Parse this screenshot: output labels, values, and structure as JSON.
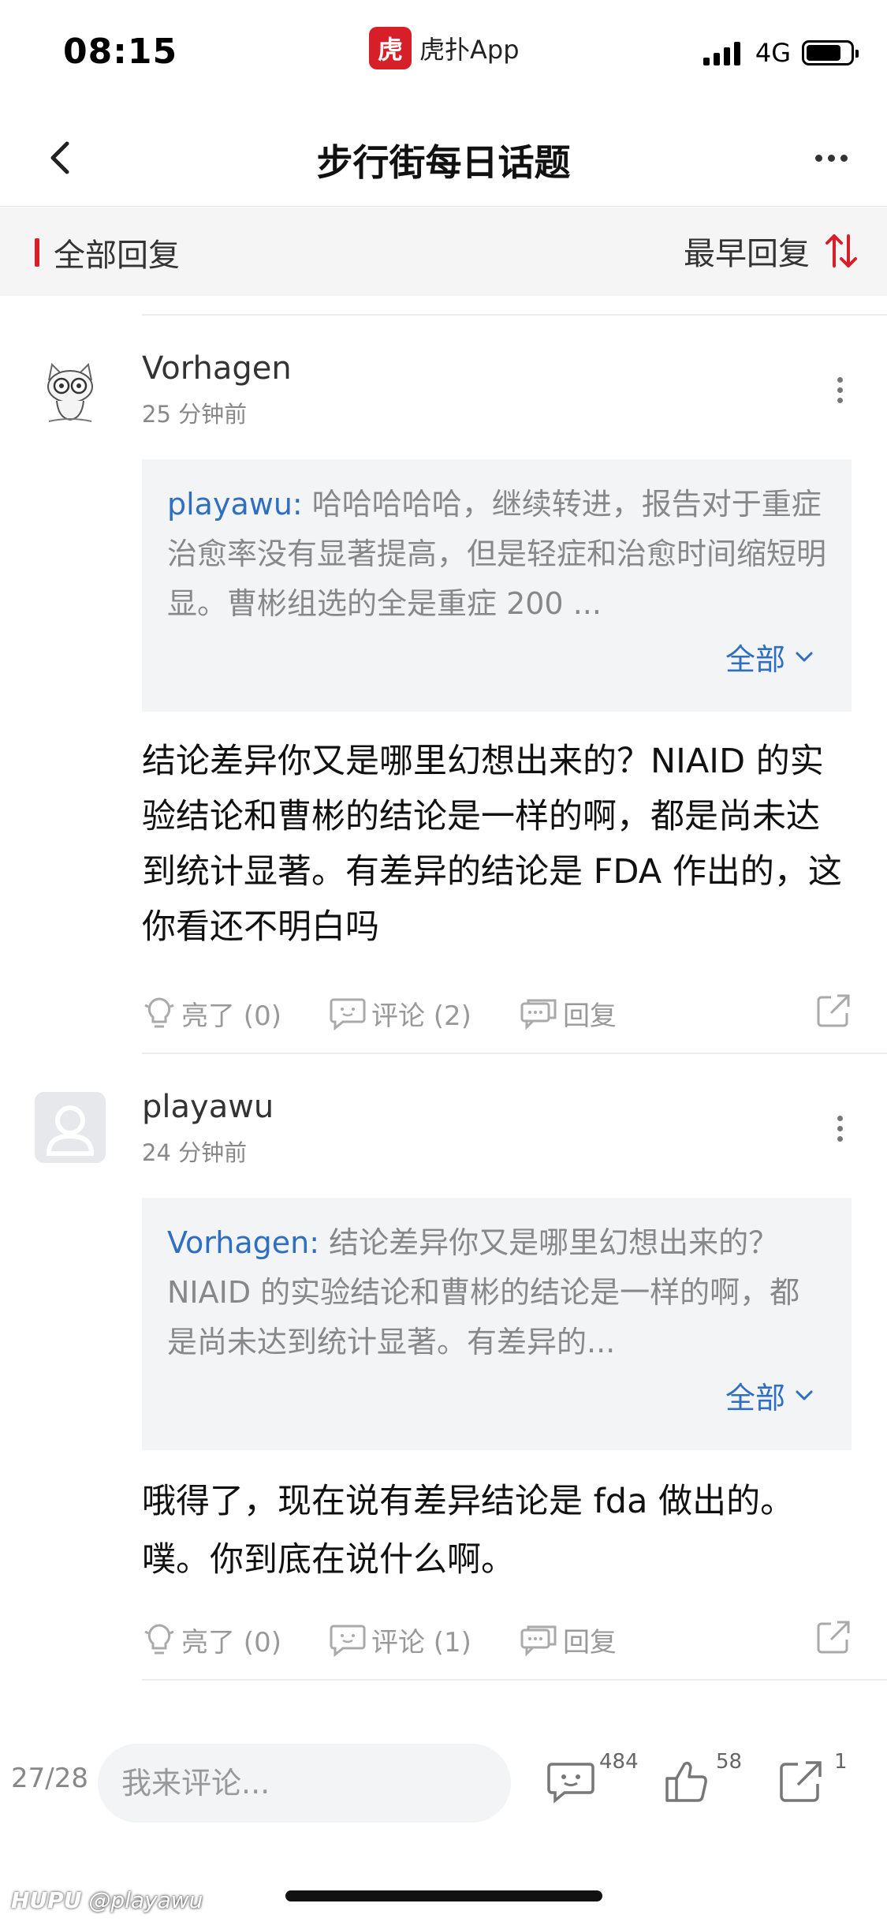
{
  "status_bar": {
    "time": "08:15",
    "app_logo_char": "虎",
    "app_name": "虎扑App",
    "network": "4G"
  },
  "nav": {
    "title": "步行街每日话题",
    "back_icon": "chevron-left-icon",
    "more_icon": "more-horizontal-icon"
  },
  "filter": {
    "all_replies": "全部回复",
    "sort_label": "最早回复",
    "sort_icon": "sort-arrows-icon",
    "accent_color": "#d71f2a"
  },
  "replies": [
    {
      "user": "Vorhagen",
      "time": "25 分钟前",
      "avatar": "cat-sketch-avatar",
      "quote_user": "playawu:",
      "quote_text": " 哈哈哈哈哈，继续转进，报告对于重症治愈率没有显著提高，但是轻症和治愈时间缩短明显。曹彬组选的全是重症 200 ...",
      "quote_expand": "全部",
      "body": "结论差异你又是哪里幻想出来的？NIAID 的实验结论和曹彬的结论是一样的啊，都是尚未达到统计显著。有差异的结论是 FDA 作出的，这你看还不明白吗",
      "light_label": "亮了 (0)",
      "comment_label": "评论 (2)",
      "reply_label": "回复"
    },
    {
      "user": "playawu",
      "time": "24 分钟前",
      "avatar": "default-user-avatar",
      "quote_user": "Vorhagen:",
      "quote_text": " 结论差异你又是哪里幻想出来的？NIAID 的实验结论和曹彬的结论是一样的啊，都是尚未达到统计显著。有差异的...",
      "quote_expand": "全部",
      "body": "哦得了，现在说有差异结论是 fda 做出的。噗。你到底在说什么啊。",
      "light_label": "亮了 (0)",
      "comment_label": "评论 (1)",
      "reply_label": "回复"
    }
  ],
  "bottom_bar": {
    "page": "27/28",
    "comment_placeholder": "我来评论...",
    "comment_count": "484",
    "like_count": "58",
    "share_count": "1"
  },
  "watermark": {
    "brand": "HUPU",
    "handle": "@playawu"
  },
  "colors": {
    "link_blue": "#2e6fc3",
    "brand_red": "#d71f2a",
    "quote_bg": "#f3f4f6"
  }
}
